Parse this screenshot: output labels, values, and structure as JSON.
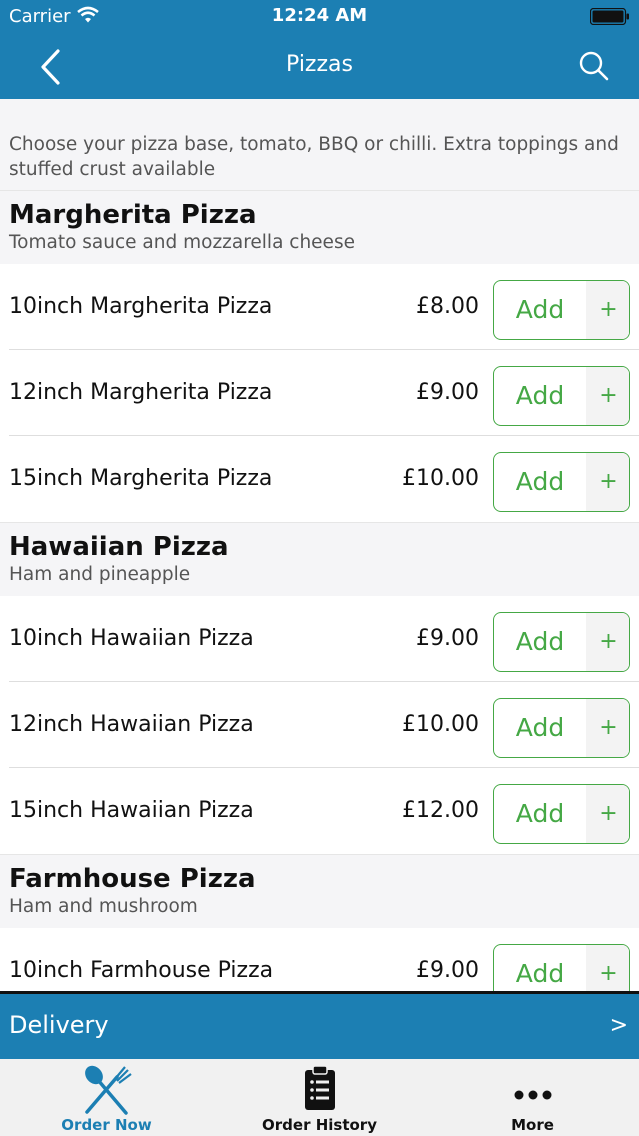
{
  "status_bar": {
    "carrier": "Carrier",
    "time": "12:24 AM"
  },
  "nav": {
    "title": "Pizzas",
    "back_icon": "chevron-left-icon",
    "search_icon": "search-icon"
  },
  "intro": "Choose your pizza base, tomato, BBQ or chilli. Extra toppings and stuffed crust available",
  "sections": [
    {
      "title": "Margherita Pizza",
      "subtitle": "Tomato sauce and mozzarella cheese",
      "items": [
        {
          "name": "10inch Margherita Pizza",
          "price": "£8.00",
          "add": "Add",
          "plus": "+"
        },
        {
          "name": "12inch Margherita Pizza",
          "price": "£9.00",
          "add": "Add",
          "plus": "+"
        },
        {
          "name": "15inch Margherita Pizza",
          "price": "£10.00",
          "add": "Add",
          "plus": "+"
        }
      ]
    },
    {
      "title": "Hawaiian Pizza",
      "subtitle": "Ham and pineapple",
      "items": [
        {
          "name": "10inch Hawaiian Pizza",
          "price": "£9.00",
          "add": "Add",
          "plus": "+"
        },
        {
          "name": "12inch Hawaiian Pizza",
          "price": "£10.00",
          "add": "Add",
          "plus": "+"
        },
        {
          "name": "15inch Hawaiian Pizza",
          "price": "£12.00",
          "add": "Add",
          "plus": "+"
        }
      ]
    },
    {
      "title": "Farmhouse Pizza",
      "subtitle": "Ham and mushroom",
      "items": [
        {
          "name": "10inch Farmhouse Pizza",
          "price": "£9.00",
          "add": "Add",
          "plus": "+"
        }
      ]
    }
  ],
  "delivery": {
    "label": "Delivery",
    "arrow": ">"
  },
  "tabs": [
    {
      "label": "Order Now",
      "icon": "fork-knife-icon",
      "active": true
    },
    {
      "label": "Order History",
      "icon": "clipboard-list-icon",
      "active": false
    },
    {
      "label": "More",
      "icon": "more-dots-icon",
      "active": false
    }
  ],
  "colors": {
    "brand": "#1c7fb3",
    "accent_green": "#45a845",
    "section_bg": "#f5f5f7"
  }
}
